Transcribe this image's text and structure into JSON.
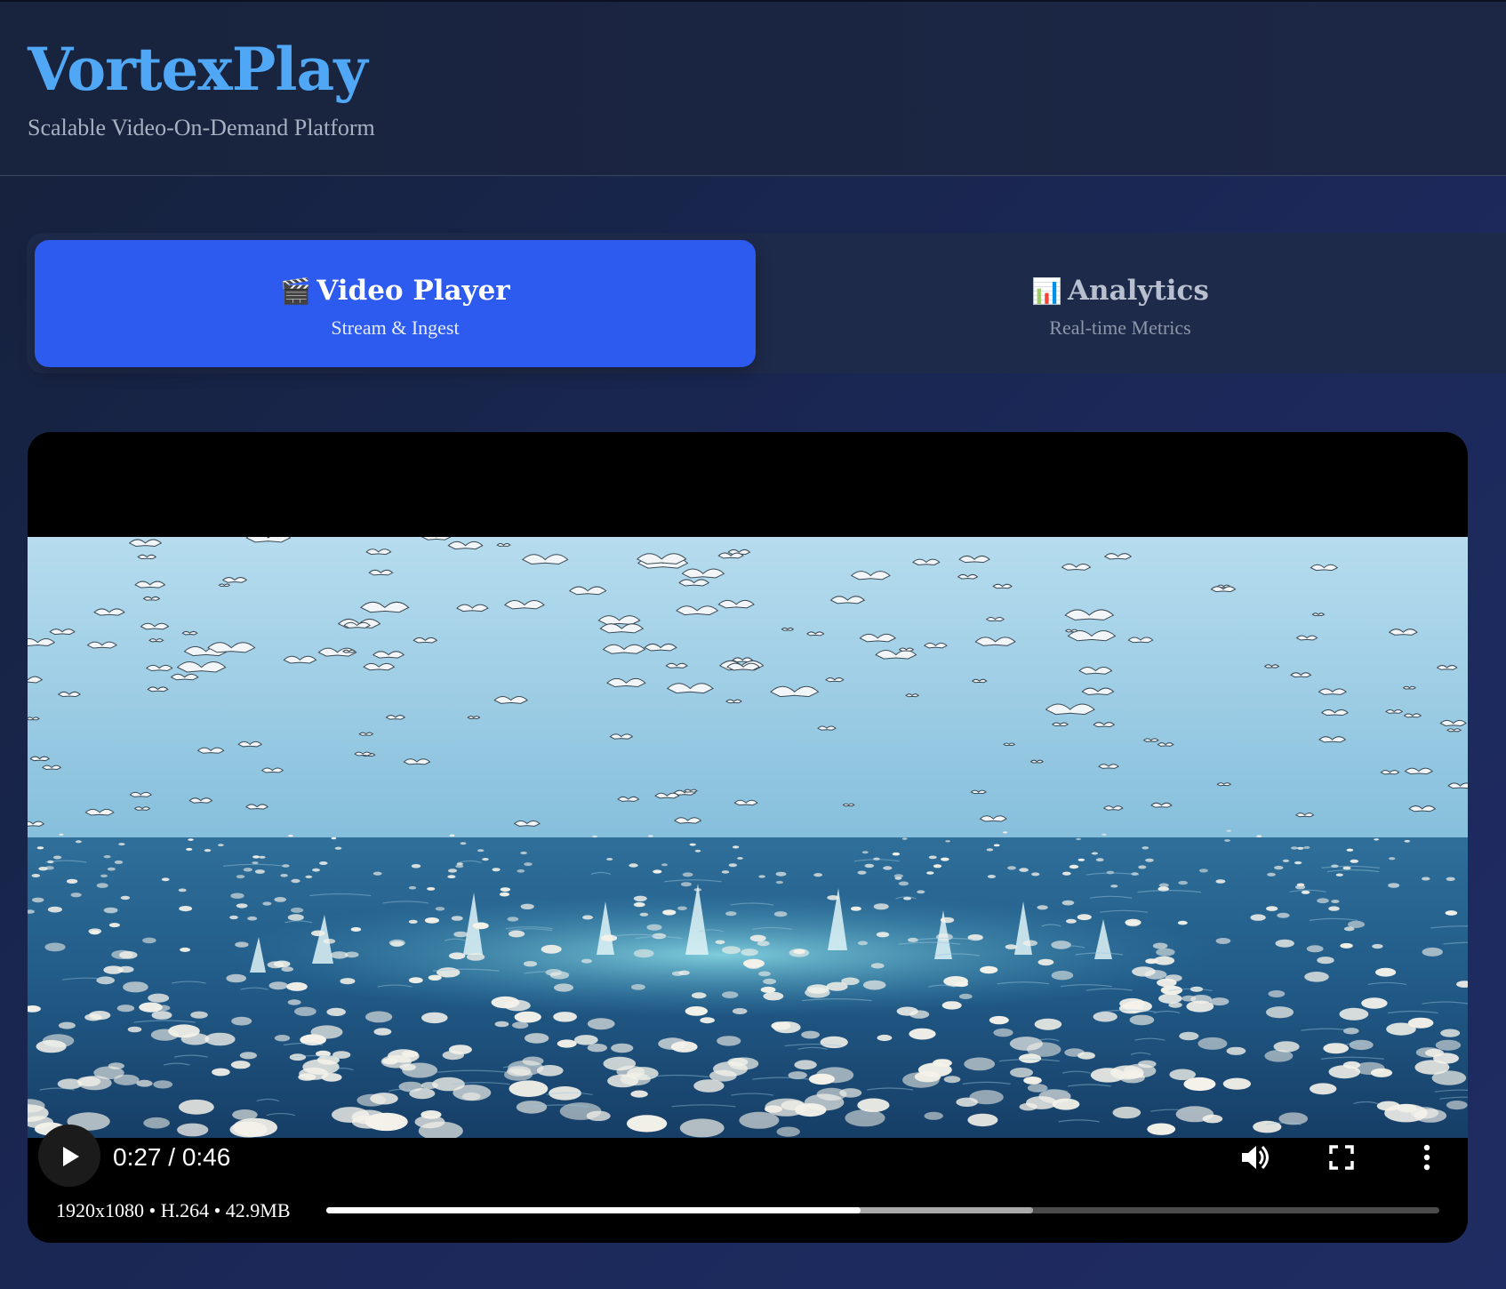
{
  "header": {
    "brand": "VortexPlay",
    "tagline": "Scalable Video-On-Demand Platform"
  },
  "tabs": [
    {
      "icon": "clapperboard-icon",
      "emoji": "🎬",
      "label": "Video Player",
      "sublabel": "Stream & Ingest",
      "active": true
    },
    {
      "icon": "bar-chart-icon",
      "emoji": "📊",
      "label": "Analytics",
      "sublabel": "Real-time Metrics",
      "active": false
    }
  ],
  "player": {
    "time_display": "0:27 / 0:46",
    "media_info": "1920x1080 • H.264 • 42.9MB",
    "progress": {
      "played_fraction": 0.48,
      "buffered_fraction": 0.635
    },
    "controls": [
      "play-icon",
      "volume-icon",
      "fullscreen-icon",
      "more-options-icon"
    ]
  }
}
